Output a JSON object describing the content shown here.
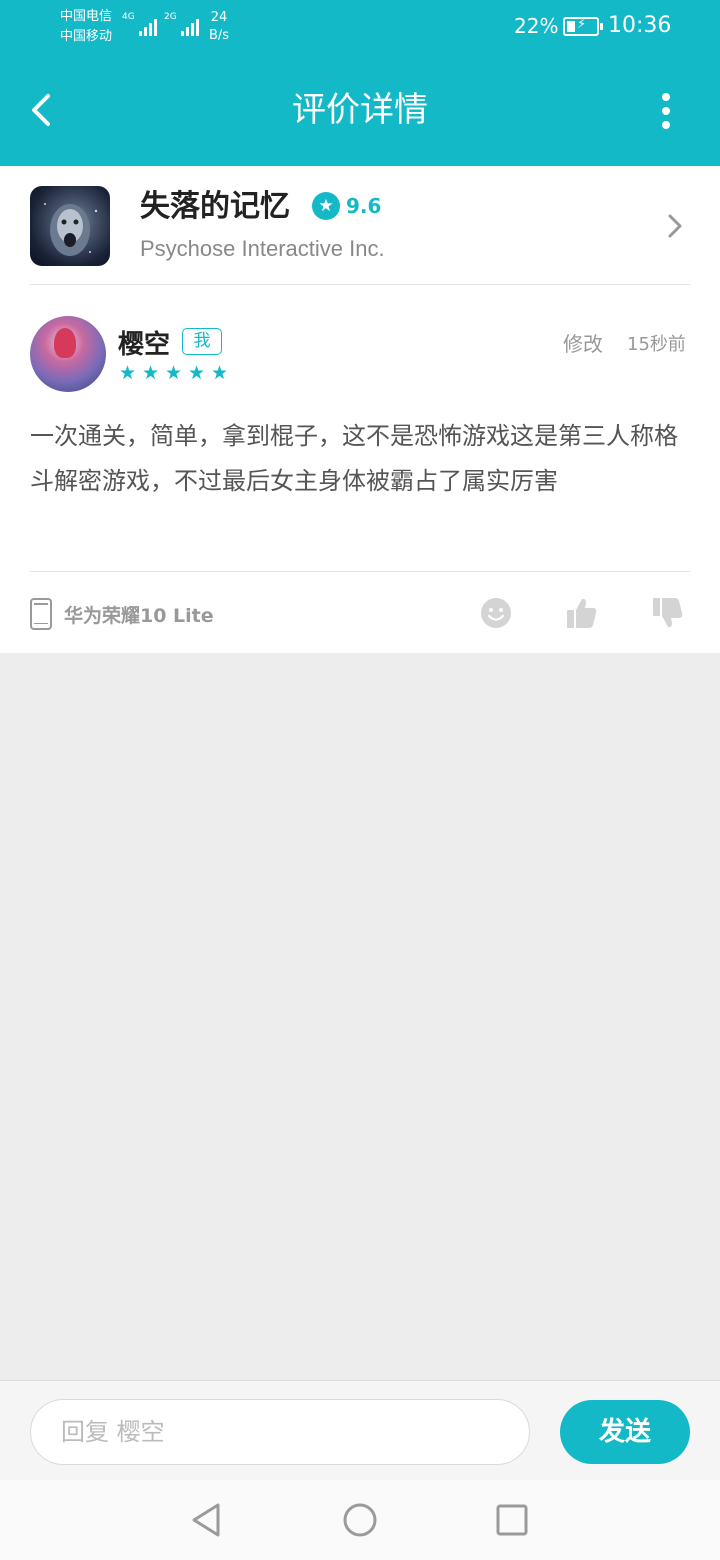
{
  "status_bar": {
    "carrier1": "中国电信",
    "carrier2": "中国移动",
    "network1": "4G",
    "network2": "2G",
    "speed_value": "24",
    "speed_unit": "B/s",
    "battery": "22%",
    "time": "10:36"
  },
  "header": {
    "title": "评价详情"
  },
  "game": {
    "name": "失落的记忆",
    "rating": "9.6",
    "developer": "Psychose Interactive Inc."
  },
  "review": {
    "username": "樱空",
    "badge": "我",
    "stars": 5,
    "edit_label": "修改",
    "time": "15秒前",
    "text": "一次通关，简单，拿到棍子，这不是恐怖游戏这是第三人称格斗解密游戏，不过最后女主身体被霸占了属实厉害",
    "device": "华为荣耀10 Lite"
  },
  "reply": {
    "placeholder": "回复 樱空",
    "send_label": "发送"
  },
  "colors": {
    "accent": "#14b9c8",
    "background": "#ededed"
  }
}
